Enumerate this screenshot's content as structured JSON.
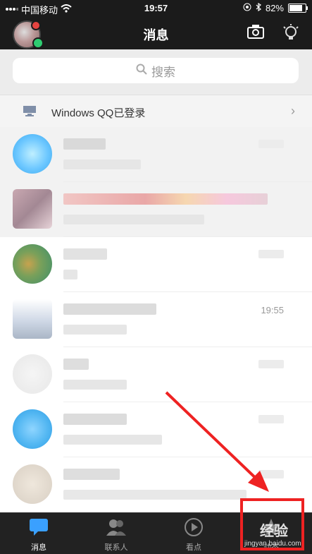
{
  "status_bar": {
    "carrier": "中国移动",
    "time": "19:57",
    "battery": "82%",
    "battery_fraction": 0.82
  },
  "nav": {
    "title": "消息"
  },
  "search": {
    "placeholder": "搜索"
  },
  "pc_login": {
    "text": "Windows QQ已登录"
  },
  "conversations": [
    {
      "time": ""
    },
    {
      "time": ""
    },
    {
      "time": ""
    },
    {
      "time": "19:55"
    },
    {
      "time": ""
    },
    {
      "time": ""
    },
    {
      "time": ""
    }
  ],
  "tabs": [
    {
      "label": "消息",
      "icon": "chat-bubble-icon",
      "active": true
    },
    {
      "label": "联系人",
      "icon": "contacts-icon",
      "active": false
    },
    {
      "label": "看点",
      "icon": "play-icon",
      "active": false
    },
    {
      "label": "动态",
      "icon": "star-icon",
      "active": false
    }
  ],
  "watermark": {
    "big": "经验",
    "small": "jingyan.baidu.com"
  },
  "colors": {
    "accent": "#3aa0ff",
    "annotation": "#e22222"
  }
}
